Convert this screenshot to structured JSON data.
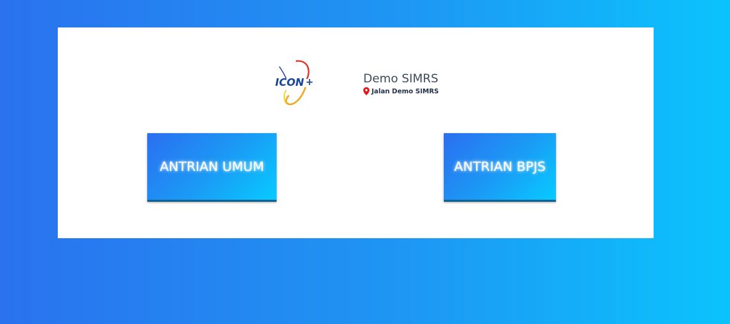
{
  "brand": {
    "logo_text": "ICON+",
    "logo_icon": "icon-plus-logo"
  },
  "hospital": {
    "name": "Demo SIMRS",
    "address": "Jalan Demo SIMRS",
    "address_icon": "map-pin-icon",
    "pin_color": "#e8141c"
  },
  "buttons": {
    "umum_label": "ANTRIAN UMUM",
    "bpjs_label": "ANTRIAN BPJS"
  },
  "colors": {
    "background_start": "#2a72ee",
    "background_end": "#0bc3fd",
    "card": "#ffffff",
    "button_start": "#2b6ff0",
    "button_end": "#07cbff"
  }
}
